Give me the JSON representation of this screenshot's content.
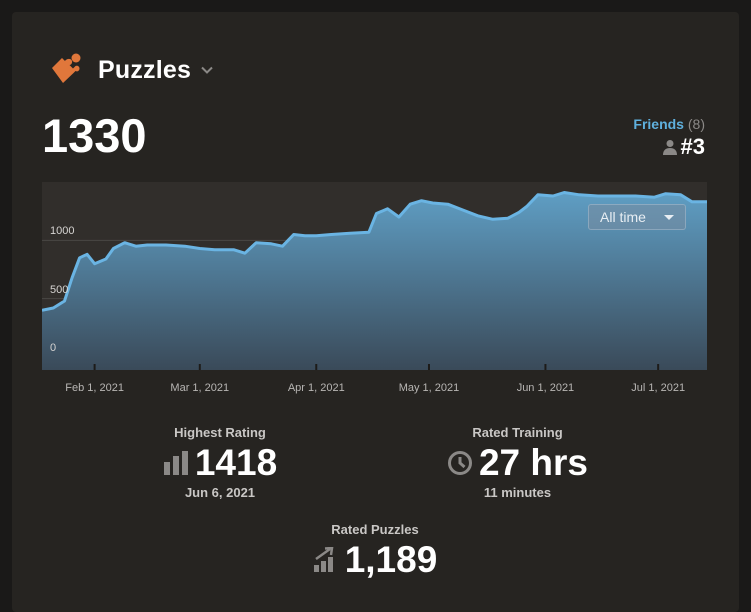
{
  "header": {
    "title": "Puzzles",
    "icon": "puzzle-piece-icon",
    "accent_color": "#e0773b"
  },
  "current_rating": "1330",
  "friends": {
    "label": "Friends",
    "count": "(8)",
    "rank": "#3"
  },
  "range_select": {
    "value": "All time"
  },
  "stats": {
    "highest_rating": {
      "label": "Highest Rating",
      "value": "1418",
      "date": "Jun 6, 2021"
    },
    "rated_training": {
      "label": "Rated Training",
      "value": "27 hrs",
      "sub": "11 minutes"
    },
    "rated_puzzles": {
      "label": "Rated Puzzles",
      "value": "1,189"
    }
  },
  "chart_data": {
    "type": "area",
    "xlabel": "",
    "ylabel": "",
    "ylim": [
      0,
      1500
    ],
    "y_ticks": [
      "0",
      "500",
      "1000"
    ],
    "x_ticks": [
      "Feb 1, 2021",
      "Mar 1, 2021",
      "Apr 1, 2021",
      "May 1, 2021",
      "Jun 1, 2021",
      "Jul 1, 2021"
    ],
    "line_color": "#6ab4e3",
    "points": [
      [
        "2021-01-18",
        400
      ],
      [
        "2021-01-21",
        420
      ],
      [
        "2021-01-24",
        480
      ],
      [
        "2021-01-26",
        680
      ],
      [
        "2021-01-28",
        850
      ],
      [
        "2021-01-30",
        880
      ],
      [
        "2021-02-01",
        800
      ],
      [
        "2021-02-04",
        840
      ],
      [
        "2021-02-06",
        930
      ],
      [
        "2021-02-09",
        980
      ],
      [
        "2021-02-12",
        950
      ],
      [
        "2021-02-15",
        960
      ],
      [
        "2021-02-20",
        960
      ],
      [
        "2021-02-25",
        950
      ],
      [
        "2021-03-01",
        930
      ],
      [
        "2021-03-05",
        920
      ],
      [
        "2021-03-10",
        920
      ],
      [
        "2021-03-13",
        890
      ],
      [
        "2021-03-16",
        980
      ],
      [
        "2021-03-20",
        970
      ],
      [
        "2021-03-23",
        950
      ],
      [
        "2021-03-26",
        1050
      ],
      [
        "2021-03-29",
        1040
      ],
      [
        "2021-04-01",
        1040
      ],
      [
        "2021-04-05",
        1050
      ],
      [
        "2021-04-10",
        1060
      ],
      [
        "2021-04-15",
        1070
      ],
      [
        "2021-04-17",
        1230
      ],
      [
        "2021-04-20",
        1270
      ],
      [
        "2021-04-23",
        1200
      ],
      [
        "2021-04-26",
        1310
      ],
      [
        "2021-04-29",
        1340
      ],
      [
        "2021-05-02",
        1320
      ],
      [
        "2021-05-06",
        1310
      ],
      [
        "2021-05-10",
        1260
      ],
      [
        "2021-05-14",
        1210
      ],
      [
        "2021-05-18",
        1180
      ],
      [
        "2021-05-22",
        1190
      ],
      [
        "2021-05-25",
        1240
      ],
      [
        "2021-05-27",
        1290
      ],
      [
        "2021-05-30",
        1390
      ],
      [
        "2021-06-03",
        1380
      ],
      [
        "2021-06-06",
        1410
      ],
      [
        "2021-06-10",
        1390
      ],
      [
        "2021-06-15",
        1380
      ],
      [
        "2021-06-20",
        1380
      ],
      [
        "2021-06-25",
        1380
      ],
      [
        "2021-06-30",
        1370
      ],
      [
        "2021-07-03",
        1400
      ],
      [
        "2021-07-07",
        1390
      ],
      [
        "2021-07-10",
        1330
      ],
      [
        "2021-07-14",
        1330
      ]
    ]
  }
}
